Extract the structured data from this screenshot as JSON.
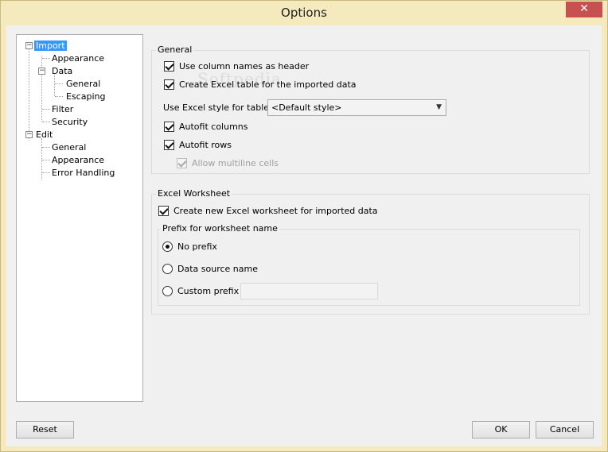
{
  "window": {
    "title": "Options",
    "close_label": "✕"
  },
  "tree": {
    "items": [
      {
        "label": "Import"
      },
      {
        "label": "Appearance"
      },
      {
        "label": "Data"
      },
      {
        "label": "General"
      },
      {
        "label": "Escaping"
      },
      {
        "label": "Filter"
      },
      {
        "label": "Security"
      },
      {
        "label": "Edit"
      },
      {
        "label": "General"
      },
      {
        "label": "Appearance"
      },
      {
        "label": "Error Handling"
      }
    ],
    "expander_minus": "−"
  },
  "general": {
    "title": "General",
    "use_column_names": "Use column names as header",
    "create_excel_table": "Create Excel table for the imported data",
    "style_label": "Use Excel style for table",
    "style_value": "<Default style>",
    "autofit_columns": "Autofit columns",
    "autofit_rows": "Autofit rows",
    "allow_multiline": "Allow multiline cells"
  },
  "worksheet": {
    "title": "Excel Worksheet",
    "create_new": "Create new Excel worksheet for imported data",
    "prefix_title": "Prefix for worksheet name",
    "no_prefix": "No prefix",
    "data_source_name": "Data source name",
    "custom_prefix": "Custom prefix",
    "custom_prefix_value": ""
  },
  "buttons": {
    "reset": "Reset",
    "ok": "OK",
    "cancel": "Cancel"
  },
  "watermark": "Softpedia"
}
